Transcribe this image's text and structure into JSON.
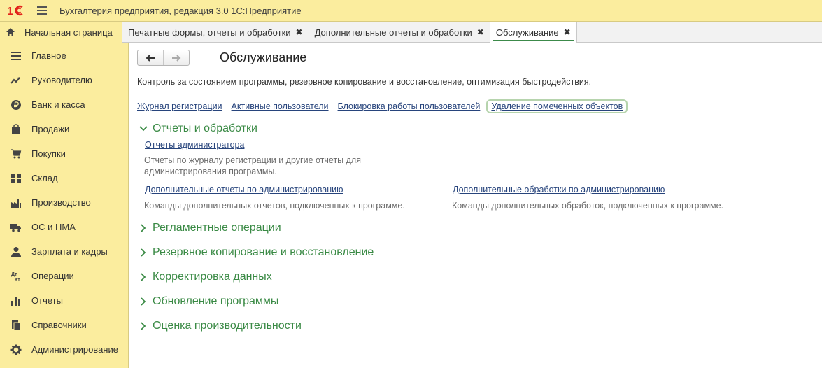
{
  "titlebar": {
    "logo": "1С",
    "title": "Бухгалтерия предприятия, редакция 3.0 1С:Предприятие"
  },
  "tabs": [
    {
      "label": "Начальная страница",
      "icon": "home-icon"
    },
    {
      "label": "Печатные формы, отчеты и обработки",
      "close": "✖"
    },
    {
      "label": "Дополнительные отчеты и обработки",
      "close": "✖"
    },
    {
      "label": "Обслуживание",
      "close": "✖",
      "active": true
    }
  ],
  "sidebar": {
    "items": [
      {
        "label": "Главное",
        "icon": "list-icon"
      },
      {
        "label": "Руководителю",
        "icon": "trend-icon"
      },
      {
        "label": "Банк и касса",
        "icon": "ruble-icon"
      },
      {
        "label": "Продажи",
        "icon": "bag-icon"
      },
      {
        "label": "Покупки",
        "icon": "cart-icon"
      },
      {
        "label": "Склад",
        "icon": "warehouse-icon"
      },
      {
        "label": "Производство",
        "icon": "factory-icon"
      },
      {
        "label": "ОС и НМА",
        "icon": "truck-icon"
      },
      {
        "label": "Зарплата и кадры",
        "icon": "person-icon"
      },
      {
        "label": "Операции",
        "icon": "dt-kt-icon"
      },
      {
        "label": "Отчеты",
        "icon": "bar-chart-icon"
      },
      {
        "label": "Справочники",
        "icon": "books-icon"
      },
      {
        "label": "Администрирование",
        "icon": "gear-icon"
      }
    ]
  },
  "main": {
    "title": "Обслуживание",
    "description": "Контроль за состоянием программы, резервное копирование и восстановление, оптимизация быстродействия.",
    "links": [
      "Журнал регистрации",
      "Активные пользователи",
      "Блокировка работы пользователей",
      "Удаление помеченных объектов"
    ],
    "sections": [
      {
        "title": "Отчеты и обработки",
        "expanded": true,
        "items": [
          {
            "link": "Отчеты администратора",
            "desc_line1": "Отчеты по журналу регистрации и другие отчеты для",
            "desc_line2": "администрирования программы."
          },
          {
            "link": "Дополнительные отчеты по администрированию",
            "desc": "Команды дополнительных отчетов, подключенных к программе."
          },
          {
            "link": "Дополнительные обработки по администрированию",
            "desc": "Команды дополнительных обработок, подключенных к программе."
          }
        ]
      },
      {
        "title": "Регламентные операции",
        "expanded": false
      },
      {
        "title": "Резервное копирование и восстановление",
        "expanded": false
      },
      {
        "title": "Корректировка данных",
        "expanded": false
      },
      {
        "title": "Обновление программы",
        "expanded": false
      },
      {
        "title": "Оценка производительности",
        "expanded": false
      }
    ]
  },
  "colors": {
    "accent_yellow": "#fbed9e",
    "section_green": "#3a8a45",
    "link_blue": "#27447c",
    "logo_red": "#e2231a"
  }
}
